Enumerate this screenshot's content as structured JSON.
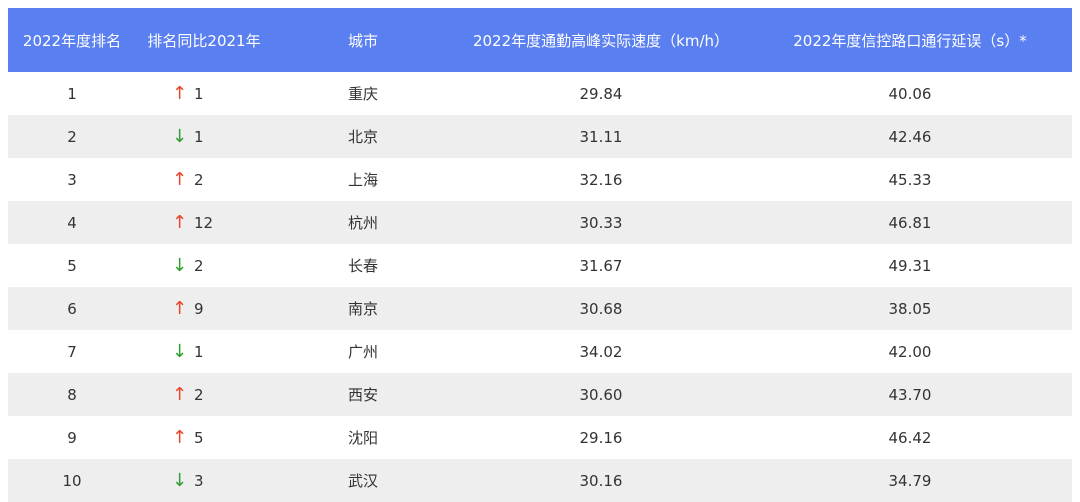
{
  "chart_data": {
    "type": "table",
    "columns": [
      "2022年度排名",
      "排名同比2021年",
      "城市",
      "2022年度通勤高峰实际速度（km/h）",
      "2022年度信控路口通行延误（s）*"
    ],
    "rows": [
      {
        "rank": "1",
        "change_dir": "up",
        "change": "1",
        "city": "重庆",
        "speed": "29.84",
        "delay": "40.06"
      },
      {
        "rank": "2",
        "change_dir": "down",
        "change": "1",
        "city": "北京",
        "speed": "31.11",
        "delay": "42.46"
      },
      {
        "rank": "3",
        "change_dir": "up",
        "change": "2",
        "city": "上海",
        "speed": "32.16",
        "delay": "45.33"
      },
      {
        "rank": "4",
        "change_dir": "up",
        "change": "12",
        "city": "杭州",
        "speed": "30.33",
        "delay": "46.81"
      },
      {
        "rank": "5",
        "change_dir": "down",
        "change": "2",
        "city": "长春",
        "speed": "31.67",
        "delay": "49.31"
      },
      {
        "rank": "6",
        "change_dir": "up",
        "change": "9",
        "city": "南京",
        "speed": "30.68",
        "delay": "38.05"
      },
      {
        "rank": "7",
        "change_dir": "down",
        "change": "1",
        "city": "广州",
        "speed": "34.02",
        "delay": "42.00"
      },
      {
        "rank": "8",
        "change_dir": "up",
        "change": "2",
        "city": "西安",
        "speed": "30.60",
        "delay": "43.70"
      },
      {
        "rank": "9",
        "change_dir": "up",
        "change": "5",
        "city": "沈阳",
        "speed": "29.16",
        "delay": "46.42"
      },
      {
        "rank": "10",
        "change_dir": "down",
        "change": "3",
        "city": "武汉",
        "speed": "30.16",
        "delay": "34.79"
      }
    ]
  },
  "colors": {
    "header_bg": "#5a7ff0",
    "header_text": "#ffffff",
    "row_alt_bg": "#eeeeee",
    "arrow_up": "#e8452a",
    "arrow_down": "#2f9e2f"
  }
}
